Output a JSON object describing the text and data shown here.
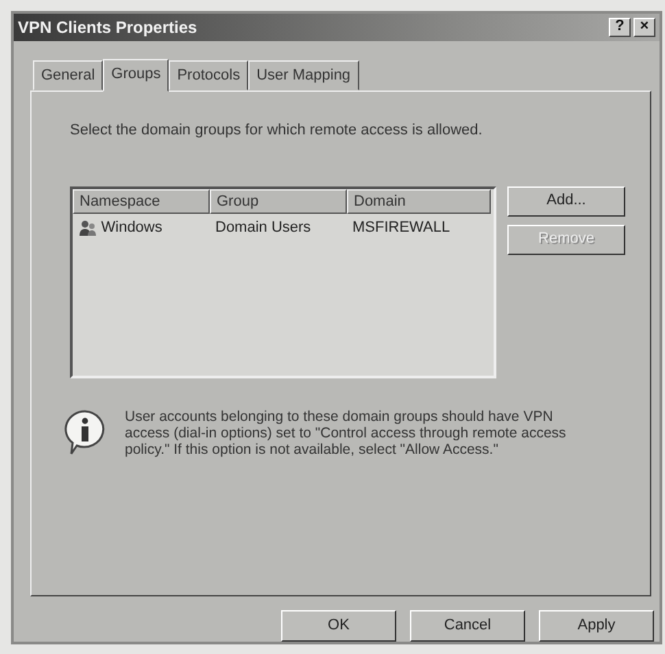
{
  "window": {
    "title": "VPN Clients Properties",
    "controls": [
      "?",
      "×"
    ]
  },
  "tabs": [
    {
      "label": "General",
      "selected": false
    },
    {
      "label": "Groups",
      "selected": true
    },
    {
      "label": "Protocols",
      "selected": false
    },
    {
      "label": "User Mapping",
      "selected": false
    }
  ],
  "instruction": "Select the domain groups for which remote access is allowed.",
  "table": {
    "columns": [
      "Namespace",
      "Group",
      "Domain"
    ],
    "rows": [
      {
        "cells": [
          "Windows",
          "Domain Users",
          "MSFIREWALL"
        ],
        "selected": false
      }
    ]
  },
  "side_buttons": [
    {
      "label": "Add...",
      "disabled": false
    },
    {
      "label": "Remove",
      "disabled": true
    }
  ],
  "info": "User accounts belonging to these domain groups should have VPN access (dial-in options) set to \"Control access through remote access policy.\" If this option is not available, select \"Allow Access.\"",
  "buttons": [
    {
      "label": "OK",
      "disabled": false
    },
    {
      "label": "Cancel",
      "disabled": false
    },
    {
      "label": "Apply",
      "disabled": false
    }
  ]
}
